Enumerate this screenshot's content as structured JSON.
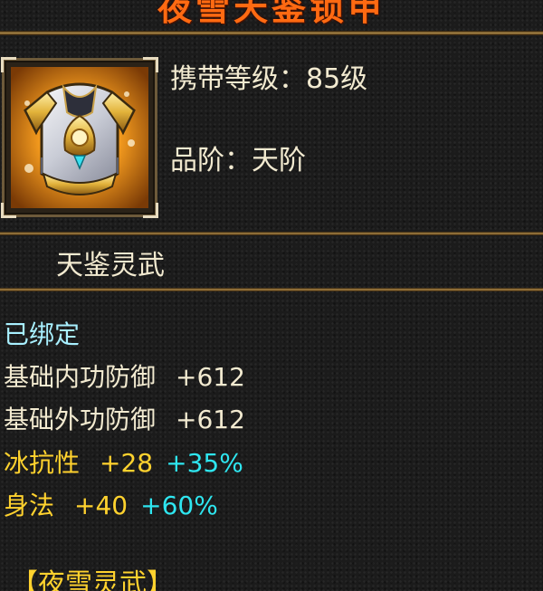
{
  "item": {
    "name": "夜雪天鉴锁甲",
    "icon": "armor-chestplate-icon",
    "level_label": "携带等级：85级",
    "grade_label": "品阶：天阶"
  },
  "category": {
    "label": "天鉴灵武"
  },
  "status": {
    "bound": "已绑定"
  },
  "stats": [
    {
      "name": "基础内功防御",
      "value": "+612",
      "percent": ""
    },
    {
      "name": "基础外功防御",
      "value": "+612",
      "percent": ""
    },
    {
      "name": "冰抗性",
      "value": "+28",
      "percent": "+35%"
    },
    {
      "name": "身法",
      "value": "+40",
      "percent": "+60%"
    }
  ],
  "set": {
    "label": "【夜雪灵武】"
  },
  "colors": {
    "title": "#ff6a12",
    "base_text": "#f2ead0",
    "bound_text": "#a8f0ff",
    "element_text": "#ffd22e",
    "percent_text": "#2ee6f0",
    "divider": "#c7a25a"
  }
}
